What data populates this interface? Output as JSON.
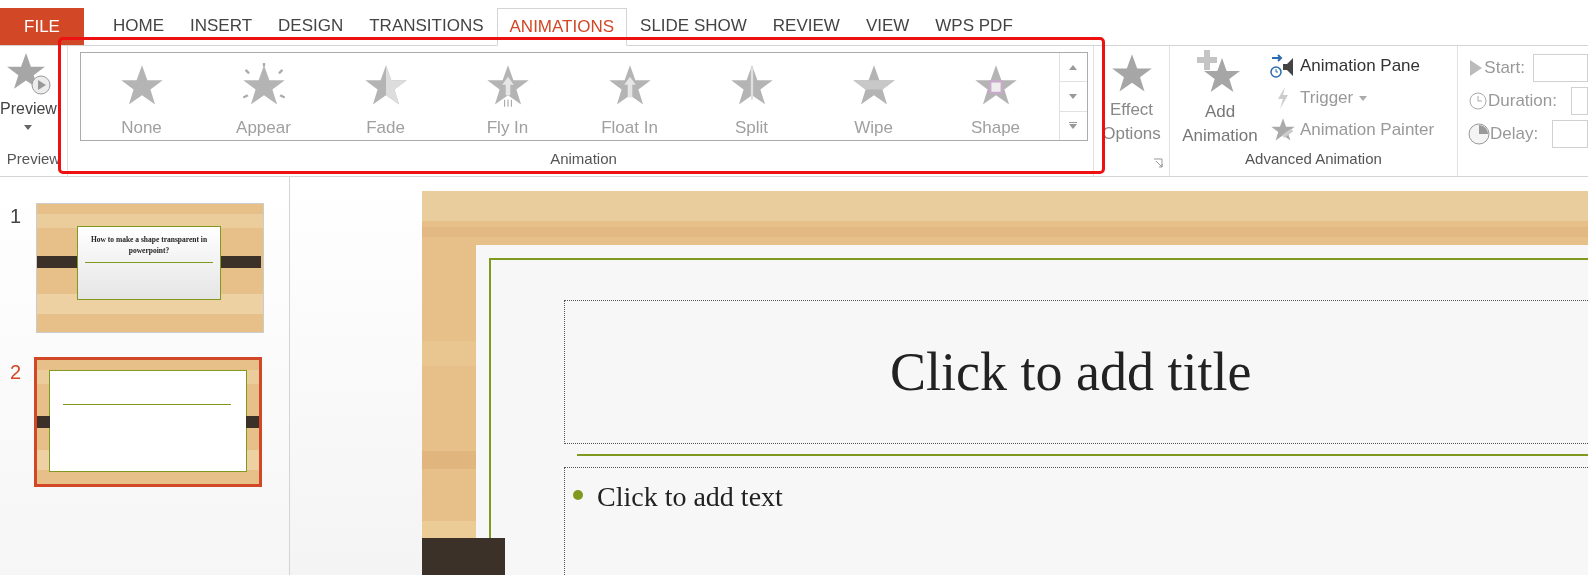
{
  "tabs": [
    {
      "label": "FILE",
      "kind": "file",
      "selected": false
    },
    {
      "label": "HOME",
      "kind": "tab",
      "selected": false
    },
    {
      "label": "INSERT",
      "kind": "tab",
      "selected": false
    },
    {
      "label": "DESIGN",
      "kind": "tab",
      "selected": false
    },
    {
      "label": "TRANSITIONS",
      "kind": "tab",
      "selected": false
    },
    {
      "label": "ANIMATIONS",
      "kind": "tab",
      "selected": true
    },
    {
      "label": "SLIDE SHOW",
      "kind": "tab",
      "selected": false
    },
    {
      "label": "REVIEW",
      "kind": "tab",
      "selected": false
    },
    {
      "label": "VIEW",
      "kind": "tab",
      "selected": false
    },
    {
      "label": "WPS PDF",
      "kind": "tab",
      "selected": false
    }
  ],
  "preview_group": {
    "button": "Preview",
    "label": "Preview"
  },
  "animation_group": {
    "label": "Animation",
    "effects": [
      {
        "label": "None",
        "kind": "none"
      },
      {
        "label": "Appear",
        "kind": "appear"
      },
      {
        "label": "Fade",
        "kind": "fade"
      },
      {
        "label": "Fly In",
        "kind": "flyin"
      },
      {
        "label": "Float In",
        "kind": "floatin"
      },
      {
        "label": "Split",
        "kind": "split"
      },
      {
        "label": "Wipe",
        "kind": "wipe"
      },
      {
        "label": "Shape",
        "kind": "shape"
      }
    ]
  },
  "effect_options": {
    "label": "Effect Options",
    "disabled": true
  },
  "advanced_animation": {
    "label": "Advanced Animation",
    "add_button": "Add Animation",
    "items": [
      {
        "label": "Animation Pane",
        "kind": "pane",
        "disabled": false
      },
      {
        "label": "Trigger",
        "kind": "trigger",
        "disabled": true
      },
      {
        "label": "Animation Painter",
        "kind": "painter",
        "disabled": true
      }
    ]
  },
  "timing": {
    "items": [
      {
        "label": "Start:",
        "kind": "start",
        "disabled": true
      },
      {
        "label": "Duration:",
        "kind": "duration",
        "disabled": true
      },
      {
        "label": "Delay:",
        "kind": "delay",
        "disabled": true
      }
    ]
  },
  "slides": [
    {
      "number": "1",
      "selected": false,
      "title": "How to make a shape transparent in powerpoint?"
    },
    {
      "number": "2",
      "selected": true
    }
  ],
  "slide": {
    "title_placeholder": "Click to add title",
    "body_placeholder": "Click to add text"
  }
}
